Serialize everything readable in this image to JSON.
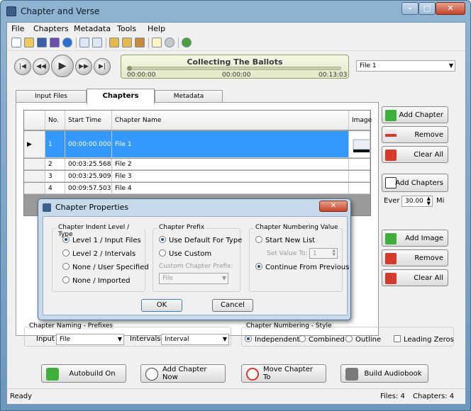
{
  "window": {
    "title": "Chapter and Verse",
    "minimize": "–",
    "maximize": "□",
    "close": "✕"
  },
  "menu": [
    "File",
    "Chapters",
    "Metadata",
    "Tools",
    "Help"
  ],
  "toolbar_icons": [
    "new-icon",
    "open-icon",
    "save-icon",
    "save-as-icon",
    "info-icon",
    "align-left-icon",
    "align-center-icon",
    "import-chapters-icon",
    "export-chapters-icon",
    "export-icon",
    "notes-icon",
    "settings-icon",
    "help-icon"
  ],
  "player": {
    "song": "Collecting The Ballots",
    "time_left": "00:00:00",
    "time_mid": "00:00:00",
    "time_right": "00:13:03",
    "progress": 0.0,
    "file_select": "File 1"
  },
  "tabs": [
    "Input Files",
    "Chapters",
    "Metadata"
  ],
  "grid": {
    "headers": [
      "No.",
      "Start Time",
      "Chapter Name",
      "Image"
    ],
    "rows": [
      {
        "no": "1",
        "time": "00:00:00.000",
        "name": "File 1",
        "selected": true
      },
      {
        "no": "2",
        "time": "00:03:25.568",
        "name": "File 2"
      },
      {
        "no": "3",
        "time": "00:03:25.909",
        "name": "File 3"
      },
      {
        "no": "4",
        "time": "00:09:57.503",
        "name": "File 4"
      }
    ]
  },
  "side": {
    "add_chapter": "Add Chapter",
    "remove": "Remove",
    "clear_all": "Clear All",
    "add_chapters": "Add Chapters",
    "every_label": "Ever",
    "every_value": "30.00",
    "unit": "Mi",
    "add_image": "Add Image",
    "remove_image": "Remove",
    "clear_all_images": "Clear All"
  },
  "dialog": {
    "title": "Chapter Properties",
    "close": "✕",
    "indent": {
      "title": "Chapter Indent Level / Type",
      "options": [
        "Level 1 / Input Files",
        "Level 2 / Intervals",
        "None / User Specified",
        "None / Imported"
      ],
      "selected": 0
    },
    "prefix": {
      "title": "Chapter Prefix",
      "options": [
        "Use Default For Type",
        "Use Custom"
      ],
      "selected": 0,
      "custom_label": "Custom Chapter Prefix:",
      "custom_value": "File"
    },
    "numbering": {
      "title": "Chapter Numbering Value",
      "start_new": "Start New List",
      "set_value_label": "Set Value To:",
      "set_value": "1",
      "continue": "Continue From Previous",
      "selected": 1
    },
    "ok": "OK",
    "cancel": "Cancel"
  },
  "naming": {
    "title": "Chapter Naming - Prefixes",
    "input_label": "Input",
    "input_value": "File",
    "intervals_label": "Intervals",
    "intervals_value": "Interval"
  },
  "style": {
    "title": "Chapter Numbering - Style",
    "options": [
      "Independent",
      "Combined",
      "Outline"
    ],
    "selected": 0,
    "leading_zeros": "Leading Zeros"
  },
  "actions": {
    "autobuild": "Autobuild On",
    "add_now": "Add Chapter Now",
    "move_to": "Move Chapter To",
    "build": "Build Audiobook"
  },
  "status": {
    "ready": "Ready",
    "files": "Files: 4",
    "chapters": "Chapters: 4"
  }
}
